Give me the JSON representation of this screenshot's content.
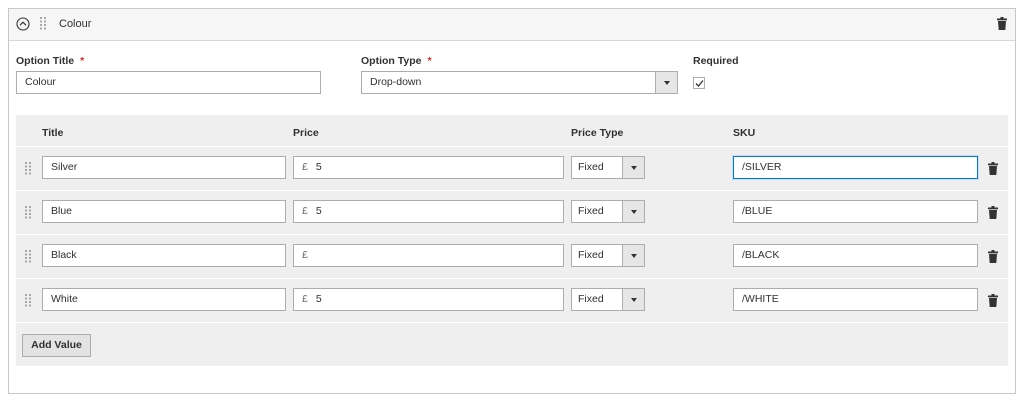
{
  "header": {
    "title": "Colour",
    "collapse_icon": "collapse-up-icon",
    "drag_icon": "drag-handle-icon",
    "delete_icon": "trash-icon"
  },
  "option": {
    "title_label": "Option Title",
    "title_value": "Colour",
    "type_label": "Option Type",
    "type_value": "Drop-down",
    "required_label": "Required",
    "required_checked": true,
    "required_marker": "*"
  },
  "columns": {
    "title": "Title",
    "price": "Price",
    "price_type": "Price Type",
    "sku": "SKU"
  },
  "currency_symbol": "£",
  "rows": [
    {
      "title": "Silver",
      "price": "5",
      "price_type": "Fixed",
      "sku": "/SILVER"
    },
    {
      "title": "Blue",
      "price": "5",
      "price_type": "Fixed",
      "sku": "/BLUE"
    },
    {
      "title": "Black",
      "price": "",
      "price_type": "Fixed",
      "sku": "/BLACK"
    },
    {
      "title": "White",
      "price": "5",
      "price_type": "Fixed",
      "sku": "/WHITE"
    }
  ],
  "add_value_label": "Add Value",
  "colors": {
    "required_star": "#e22626",
    "focus_border": "#007bdb",
    "grid_bg": "#efefef"
  }
}
